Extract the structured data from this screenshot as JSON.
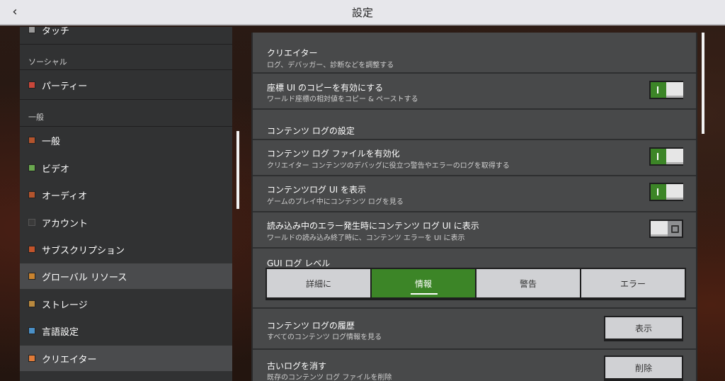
{
  "header": {
    "title": "設定",
    "back_icon": "chevron-left-icon"
  },
  "sidebar": {
    "top_partial_item": "タッチ",
    "sections": [
      {
        "label": "ソーシャル"
      },
      {
        "label": "一般"
      }
    ],
    "items": [
      {
        "label": "パーティー",
        "icon": "party-icon",
        "color": "#c8473a"
      },
      {
        "label": "一般",
        "icon": "general-icon",
        "color": "#b3542d"
      },
      {
        "label": "ビデオ",
        "icon": "video-icon",
        "color": "#6aa84f"
      },
      {
        "label": "オーディオ",
        "icon": "audio-icon",
        "color": "#b3542d"
      },
      {
        "label": "アカウント",
        "icon": "account-icon",
        "color": "#3a3a3a"
      },
      {
        "label": "サブスクリプション",
        "icon": "subscription-icon",
        "color": "#c2542b"
      },
      {
        "label": "グローバル リソース",
        "icon": "global-resources-icon",
        "color": "#c9832f"
      },
      {
        "label": "ストレージ",
        "icon": "storage-icon",
        "color": "#b9893e"
      },
      {
        "label": "言語設定",
        "icon": "language-icon",
        "color": "#4a90c8"
      },
      {
        "label": "クリエイター",
        "icon": "creator-icon",
        "color": "#e07b39"
      }
    ]
  },
  "creator": {
    "title": "クリエイター",
    "subtitle": "ログ、デバッガー、診断などを調整する"
  },
  "settings": {
    "copy_coords": {
      "title": "座標 UI のコピーを有効にする",
      "desc": "ワールド座標の相対値をコピー & ペーストする",
      "on": true
    },
    "content_log_header": "コンテンツ ログの設定",
    "content_log_file": {
      "title": "コンテンツ ログ ファイルを有効化",
      "desc": "クリエイター コンテンツのデバッグに役立つ警告やエラーのログを取得する",
      "on": true
    },
    "content_log_ui": {
      "title": "コンテンツログ UI を表示",
      "desc": "ゲームのプレイ中にコンテンツ ログを見る",
      "on": true
    },
    "load_error_ui": {
      "title": "読み込み中のエラー発生時にコンテンツ ログ UI に表示",
      "desc": "ワールドの読み込み終了時に、コンテンツ エラーを UI に表示",
      "on": false
    },
    "gui_log_level": {
      "title": "GUI ログ レベル",
      "options": [
        "詳細に",
        "情報",
        "警告",
        "エラー"
      ],
      "selected": "情報"
    },
    "log_history": {
      "title": "コンテンツ ログの履歴",
      "desc": "すべてのコンテンツ ログ情報を見る",
      "button": "表示"
    },
    "clear_logs": {
      "title": "古いログを消す",
      "desc": "既存のコンテンツ ログ ファイルを削除",
      "button": "削除"
    }
  }
}
